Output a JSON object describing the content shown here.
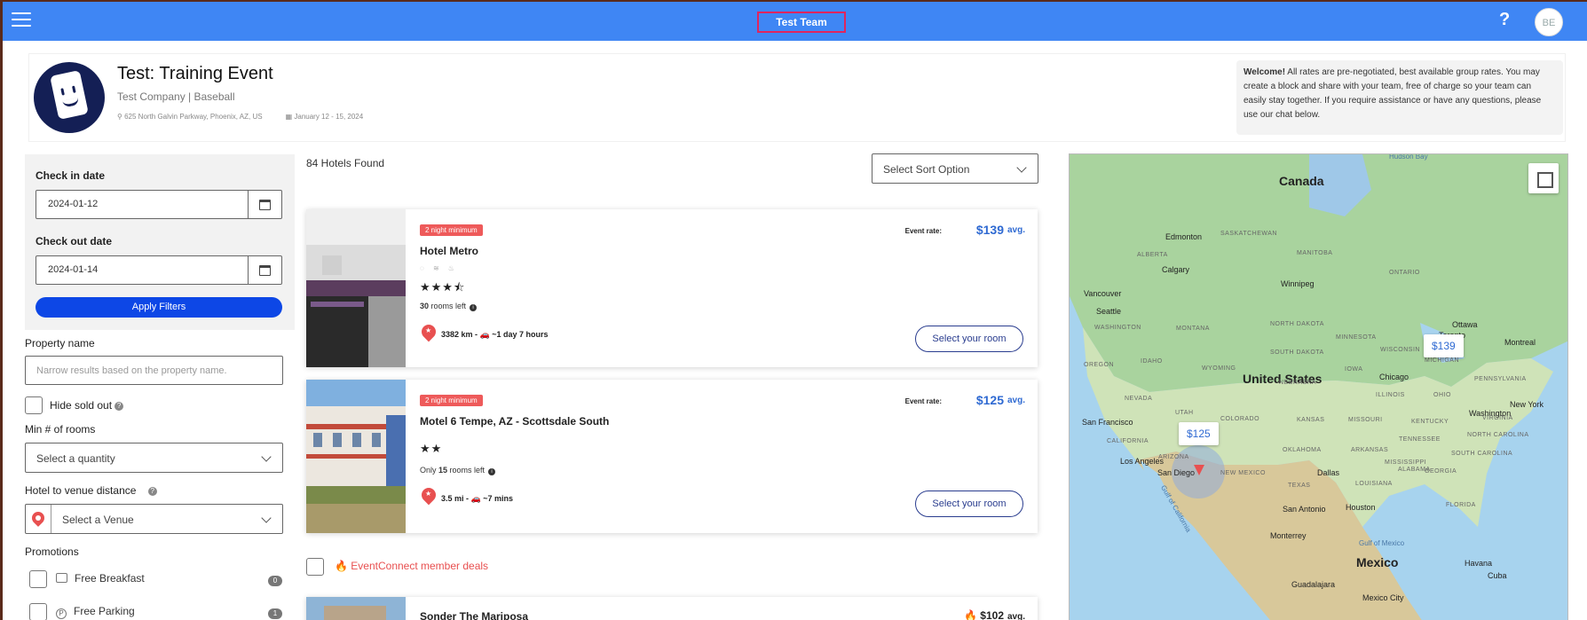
{
  "topbar": {
    "team": "Test Team",
    "help": "?",
    "avatar": "BE"
  },
  "event": {
    "title": "Test: Training Event",
    "company": "Test Company | Baseball",
    "address": "625 North Galvin Parkway, Phoenix, AZ, US",
    "dates": "January 12 - 15, 2024",
    "welcome_bold": "Welcome!",
    "welcome_text": " All rates are pre-negotiated, best available group rates. You may create a block and share with your team, free of charge so your team can easily stay together. If you require assistance or have any questions, please use our chat below."
  },
  "filters": {
    "checkin_label": "Check in date",
    "checkin_value": "2024-01-12",
    "checkout_label": "Check out date",
    "checkout_value": "2024-01-14",
    "apply": "Apply Filters",
    "property_label": "Property name",
    "property_placeholder": "Narrow results based on the property name.",
    "hide_sold_out": "Hide sold out",
    "min_rooms_label": "Min # of rooms",
    "min_rooms_value": "Select a quantity",
    "venue_label": "Hotel to venue distance",
    "venue_value": "Select a Venue",
    "promotions_label": "Promotions",
    "promotions": [
      {
        "label": "Free Breakfast",
        "count": "0"
      },
      {
        "label": "Free Parking",
        "count": "1"
      }
    ]
  },
  "results": {
    "count_text": "84 Hotels Found",
    "sort_placeholder": "Select Sort Option",
    "member_deals": "EventConnect member deals",
    "hotels": [
      {
        "badge": "2 night minimum",
        "name": "Hotel Metro",
        "stars": "★★★⯪",
        "amenities": "◌ ≋ ♨",
        "rooms_prefix": "",
        "rooms_count": "30",
        "rooms_suffix": " rooms left",
        "distance": "3382 km - 🚗 ~1 day 7 hours",
        "rate_label": "Event rate:",
        "price": "$139",
        "avg": "avg.",
        "cta": "Select your room"
      },
      {
        "badge": "2 night minimum",
        "name": "Motel 6 Tempe, AZ - Scottsdale South",
        "stars": "★★",
        "amenities": "",
        "rooms_prefix": "Only ",
        "rooms_count": "15",
        "rooms_suffix": " rooms left",
        "distance": "3.5 mi - 🚗 ~7 mins",
        "rate_label": "Event rate:",
        "price": "$125",
        "avg": "avg.",
        "cta": "Select your room"
      },
      {
        "name": "Sonder The Mariposa",
        "price": "$102",
        "avg": "avg."
      }
    ]
  },
  "map": {
    "pins": [
      {
        "label": "$139"
      },
      {
        "label": "$125"
      }
    ],
    "countries": [
      "Canada",
      "United States",
      "Mexico",
      "Cuba"
    ],
    "cities": [
      "Edmonton",
      "Calgary",
      "Vancouver",
      "Seattle",
      "Winnipeg",
      "San Francisco",
      "Los Angeles",
      "San Diego",
      "Dallas",
      "Houston",
      "San Antonio",
      "Monterrey",
      "Chicago",
      "Toronto",
      "Ottawa",
      "Montreal",
      "Washington",
      "New York",
      "Havana",
      "Guadalajara",
      "Mexico City"
    ],
    "states": [
      "SASKATCHEWAN",
      "ALBERTA",
      "MANITOBA",
      "ONTARIO",
      "WASHINGTON",
      "MONTANA",
      "NORTH DAKOTA",
      "SOUTH DAKOTA",
      "OREGON",
      "IDAHO",
      "WYOMING",
      "NEBRASKA",
      "IOWA",
      "NEVADA",
      "UTAH",
      "COLORADO",
      "KANSAS",
      "MISSOURI",
      "CALIFORNIA",
      "ARIZONA",
      "NEW MEXICO",
      "OKLAHOMA",
      "TEXAS",
      "MINNESOTA",
      "WISCONSIN",
      "MICHIGAN",
      "ILLINOIS",
      "OHIO",
      "KENTUCKY",
      "TENNESSEE",
      "ALABAMA",
      "GEORGIA",
      "ARKANSAS",
      "LOUISIANA",
      "VIRGINIA",
      "PENNSYLVANIA",
      "NORTH CAROLINA",
      "SOUTH CAROLINA",
      "MISSISSIPPI",
      "FLORIDA"
    ],
    "water": [
      "Gulf of Mexico",
      "Gulf of California",
      "Hudson Bay"
    ],
    "colors": {
      "land": "#a9d39e",
      "water": "#a7d3ee",
      "us": "#d8e8c8"
    }
  }
}
